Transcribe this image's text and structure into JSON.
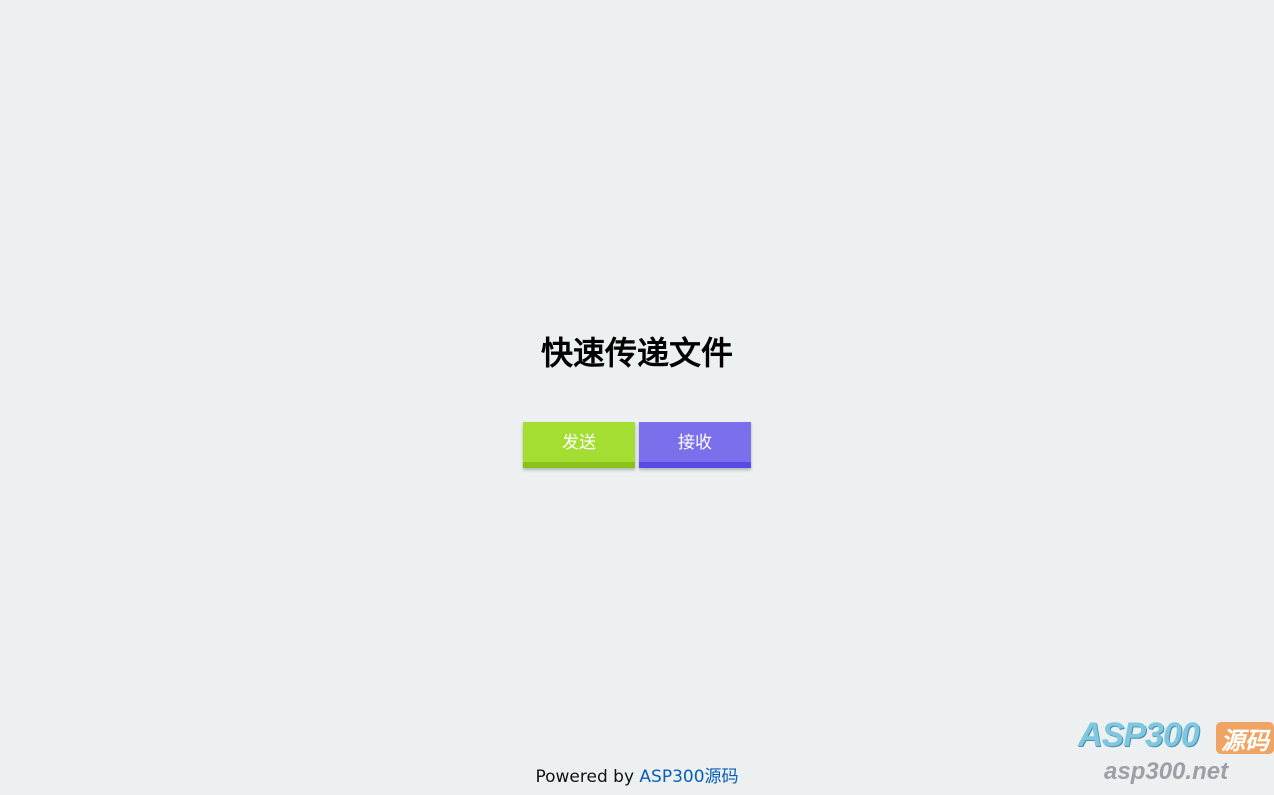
{
  "main": {
    "title": "快速传递文件",
    "send_label": "发送",
    "receive_label": "接收"
  },
  "footer": {
    "prefix": "Powered by ",
    "link_text": "ASP300源码"
  },
  "watermark": {
    "brand": "ASP300",
    "badge": "源码",
    "url": "asp300.net"
  },
  "colors": {
    "background": "#ecf0f1",
    "send": "#a4de33",
    "receive": "#7b6fec",
    "link": "#0a5db6"
  }
}
